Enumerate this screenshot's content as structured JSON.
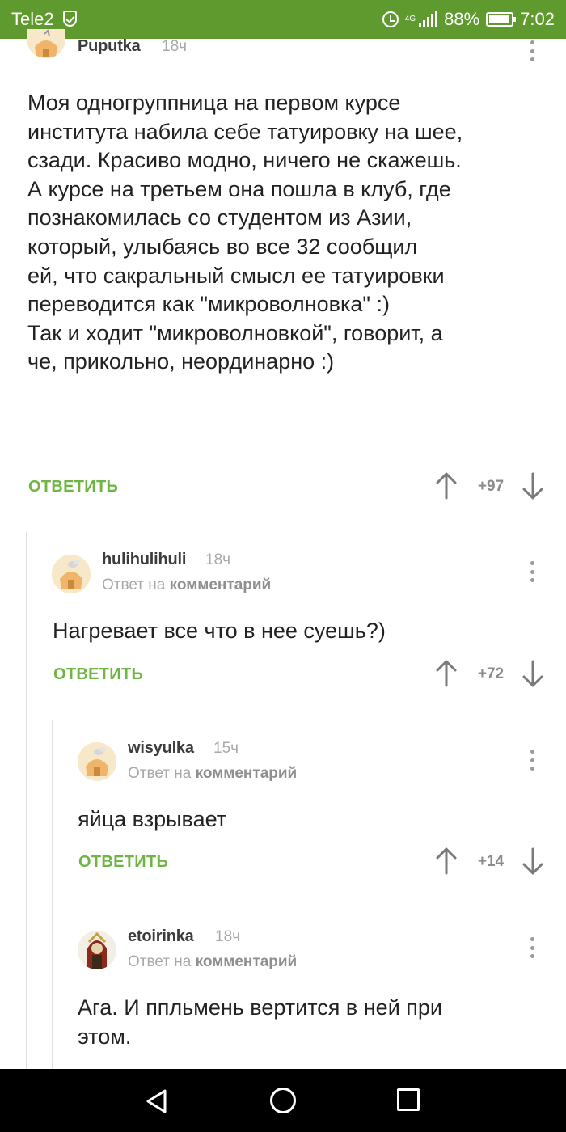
{
  "status": {
    "carrier": "Tele2",
    "network": "4G",
    "battery": "88%",
    "time": "7:02"
  },
  "comments": [
    {
      "username": "Puputka",
      "time": "18ч",
      "text": "Моя одногруппница на первом курсе\nинститута набила себе татуировку на шее,\nсзади. Красиво модно, ничего не скажешь.\nА курсе на третьем она пошла в клуб, где\nпознакомилась со студентом из Азии,\nкоторый, улыбаясь во все 32 сообщил\nей, что сакральный смысл ее татуировки\nпереводится как \"микроволновка\" :)\nТак и ходит \"микроволновкой\", говорит, а\nче, прикольно, неординарно :)",
      "reply_label": "ОТВЕТИТЬ",
      "score": "+97"
    },
    {
      "username": "hulihulihuli",
      "time": "18ч",
      "reply_prefix": "Ответ на",
      "reply_target": "комментарий",
      "text": "Нагревает все что в нее суешь?)",
      "reply_label": "ОТВЕТИТЬ",
      "score": "+72"
    },
    {
      "username": "wisyulka",
      "time": "15ч",
      "reply_prefix": "Ответ на",
      "reply_target": "комментарий",
      "text": "яйца взрывает",
      "reply_label": "ОТВЕТИТЬ",
      "score": "+14"
    },
    {
      "username": "etoirinka",
      "time": "18ч",
      "reply_prefix": "Ответ на",
      "reply_target": "комментарий",
      "text": "Ага. И ппльмень вертится в ней при\nэтом."
    }
  ],
  "colors": {
    "status_bar": "#5f9a2e",
    "reply_green": "#6fb544"
  },
  "icons": [
    "shield-icon",
    "alarm-icon",
    "signal-icon",
    "battery-icon",
    "kebab-menu-icon",
    "upvote-icon",
    "downvote-icon",
    "back-icon",
    "home-icon",
    "recents-icon"
  ]
}
